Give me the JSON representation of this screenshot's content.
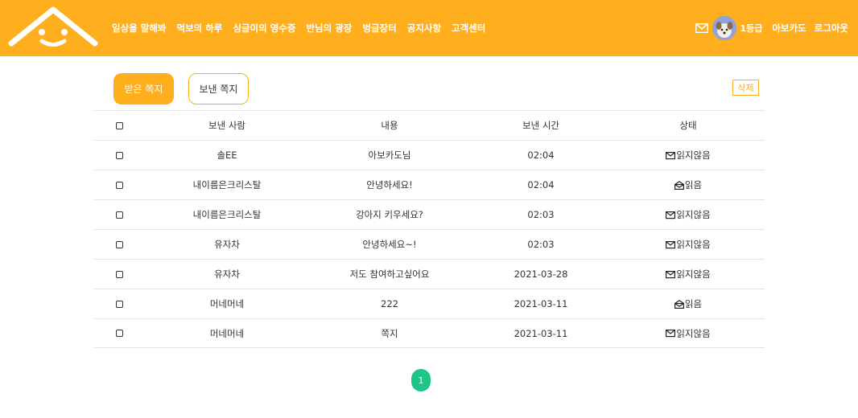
{
  "header": {
    "nav": [
      "일상을 말해봐",
      "먹보의 하루",
      "싱글이의 영수증",
      "반님의 광장",
      "벙글장터",
      "공지사항",
      "고객센터"
    ],
    "grade": "1등급",
    "username": "아보카도",
    "logout": "로그아웃"
  },
  "tabs": {
    "received": "받은 쪽지",
    "sent": "보낸 쪽지"
  },
  "delete_label": "삭제",
  "table": {
    "headers": {
      "sender": "보낸 사람",
      "content": "내용",
      "time": "보낸 시간",
      "status": "상태"
    },
    "rows": [
      {
        "sender": "솔EE",
        "content": "아보카도님",
        "time": "02:04",
        "status": "읽지않음",
        "read": false
      },
      {
        "sender": "내이름은크리스탈",
        "content": "안녕하세요!",
        "time": "02:04",
        "status": "읽음",
        "read": true
      },
      {
        "sender": "내이름은크리스탈",
        "content": "강아지 키우세요?",
        "time": "02:03",
        "status": "읽지않음",
        "read": false
      },
      {
        "sender": "유자차",
        "content": "안녕하세요~!",
        "time": "02:03",
        "status": "읽지않음",
        "read": false
      },
      {
        "sender": "유자차",
        "content": "저도 참여하고싶어요",
        "time": "2021-03-28",
        "status": "읽지않음",
        "read": false
      },
      {
        "sender": "머네머네",
        "content": "222",
        "time": "2021-03-11",
        "status": "읽음",
        "read": true
      },
      {
        "sender": "머네머네",
        "content": "쪽지",
        "time": "2021-03-11",
        "status": "읽지않음",
        "read": false
      }
    ]
  },
  "pagination": {
    "current": "1"
  },
  "colors": {
    "brand": "#FFAE1D",
    "page_active": "#1DC686"
  },
  "icons": {
    "logo": "house-smile-logo",
    "mail": "envelope-icon",
    "unread": "envelope-closed-icon",
    "read": "envelope-open-icon"
  }
}
